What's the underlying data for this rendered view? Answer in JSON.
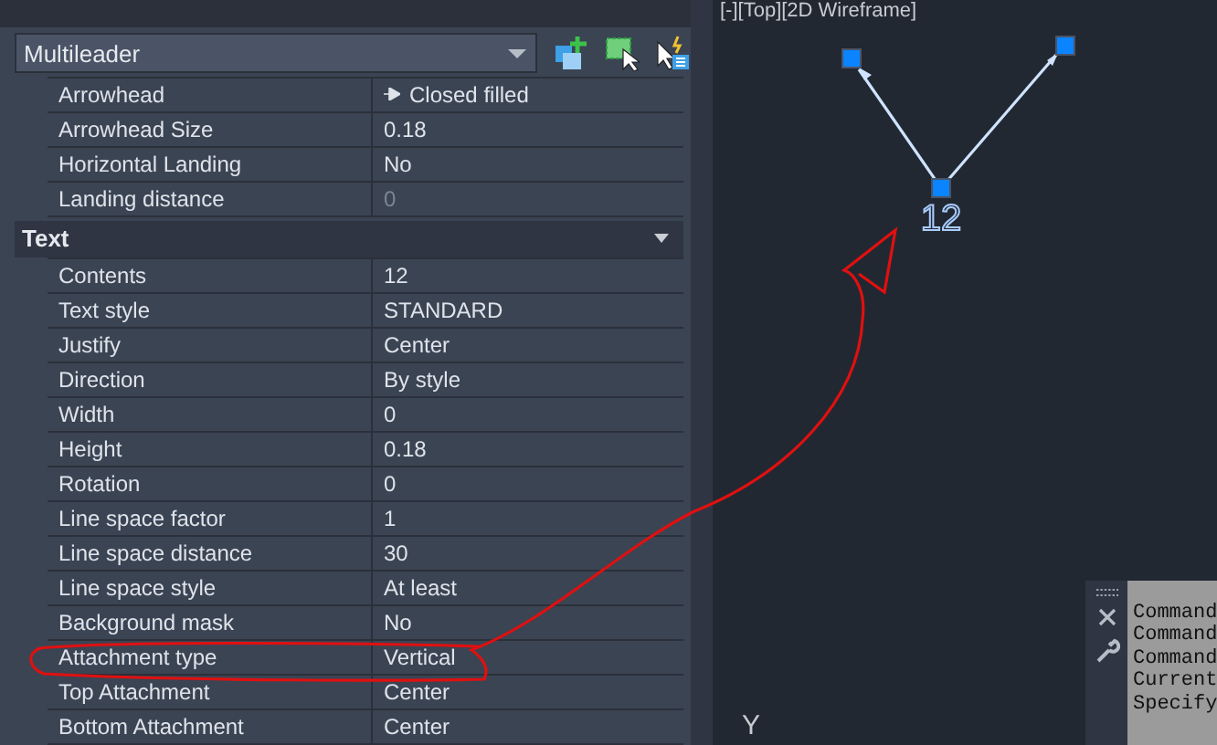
{
  "properties": {
    "object_type": "Multileader",
    "rows_top": [
      {
        "label": "Arrowhead",
        "value": "Closed filled",
        "kind": "arrow",
        "disabled": false
      },
      {
        "label": "Arrowhead Size",
        "value": "0.18",
        "kind": "plain",
        "disabled": false
      },
      {
        "label": "Horizontal Landing",
        "value": "No",
        "kind": "plain",
        "disabled": false
      },
      {
        "label": "Landing distance",
        "value": "0",
        "kind": "plain",
        "disabled": true
      }
    ],
    "sections": [
      {
        "title": "Text",
        "expanded": true,
        "rows": [
          {
            "label": "Contents",
            "value": "12",
            "kind": "plain",
            "disabled": false
          },
          {
            "label": "Text style",
            "value": "STANDARD",
            "kind": "plain",
            "disabled": false
          },
          {
            "label": "Justify",
            "value": "Center",
            "kind": "plain",
            "disabled": false
          },
          {
            "label": "Direction",
            "value": "By style",
            "kind": "plain",
            "disabled": false
          },
          {
            "label": "Width",
            "value": "0",
            "kind": "plain",
            "disabled": false
          },
          {
            "label": "Height",
            "value": "0.18",
            "kind": "plain",
            "disabled": false
          },
          {
            "label": "Rotation",
            "value": "0",
            "kind": "plain",
            "disabled": false
          },
          {
            "label": "Line space factor",
            "value": "1",
            "kind": "plain",
            "disabled": false
          },
          {
            "label": "Line space distance",
            "value": "30",
            "kind": "plain",
            "disabled": false
          },
          {
            "label": "Line space style",
            "value": "At least",
            "kind": "plain",
            "disabled": false
          },
          {
            "label": "Background mask",
            "value": "No",
            "kind": "plain",
            "disabled": false
          },
          {
            "label": "Attachment type",
            "value": "Vertical",
            "kind": "plain",
            "disabled": false
          },
          {
            "label": "Top Attachment",
            "value": "Center",
            "kind": "plain",
            "disabled": false
          },
          {
            "label": "Bottom Attachment",
            "value": "Center",
            "kind": "plain",
            "disabled": false
          }
        ]
      }
    ]
  },
  "viewport": {
    "view_label": "[-][Top][2D Wireframe]",
    "mtext": "12",
    "axis_label": "Y"
  },
  "command_window": {
    "lines": [
      "Command",
      "Command",
      "Command",
      "Current",
      "Specify"
    ]
  }
}
